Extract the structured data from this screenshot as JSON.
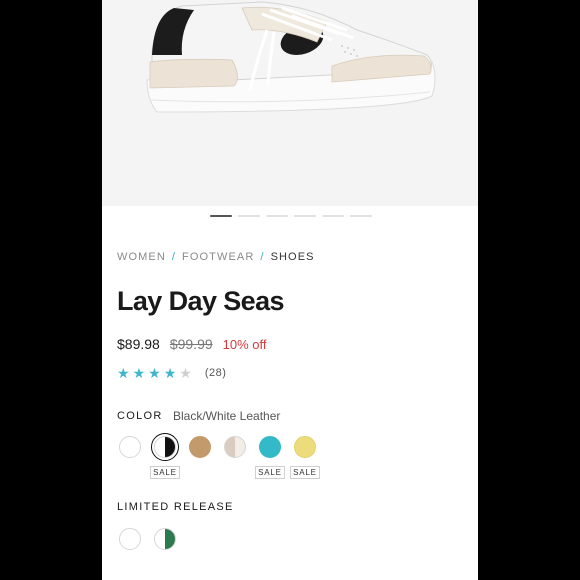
{
  "breadcrumb": {
    "items": [
      "WOMEN",
      "FOOTWEAR",
      "SHOES"
    ],
    "separator": "/"
  },
  "product": {
    "title": "Lay Day Seas",
    "price": "$89.98",
    "original_price": "$99.99",
    "discount": "10% off",
    "rating": 4,
    "rating_max": 5,
    "review_count": "(28)"
  },
  "carousel": {
    "slides": 6,
    "active_index": 0
  },
  "color": {
    "label": "COLOR",
    "selected_value": "Black/White Leather",
    "swatches": [
      {
        "name": "white",
        "colors": [
          "#ffffff"
        ],
        "sale": ""
      },
      {
        "name": "black-white",
        "colors": [
          "#111111",
          "#ffffff"
        ],
        "sale": "SALE",
        "selected": true
      },
      {
        "name": "tan",
        "colors": [
          "#c39a6b"
        ],
        "sale": ""
      },
      {
        "name": "bone-white",
        "colors": [
          "#d9cdc0",
          "#f2ede6"
        ],
        "sale": ""
      },
      {
        "name": "aqua",
        "colors": [
          "#34b9c9"
        ],
        "sale": "SALE"
      },
      {
        "name": "yellow",
        "colors": [
          "#ecdc7c"
        ],
        "sale": "SALE"
      }
    ]
  },
  "limited": {
    "label": "LIMITED RELEASE",
    "swatches": [
      {
        "name": "white",
        "colors": [
          "#ffffff"
        ]
      },
      {
        "name": "green-white",
        "colors": [
          "#2e7a4f",
          "#ffffff"
        ]
      }
    ]
  },
  "theme": {
    "accent": "#3fb6c9",
    "sale_red": "#d23b3b"
  }
}
